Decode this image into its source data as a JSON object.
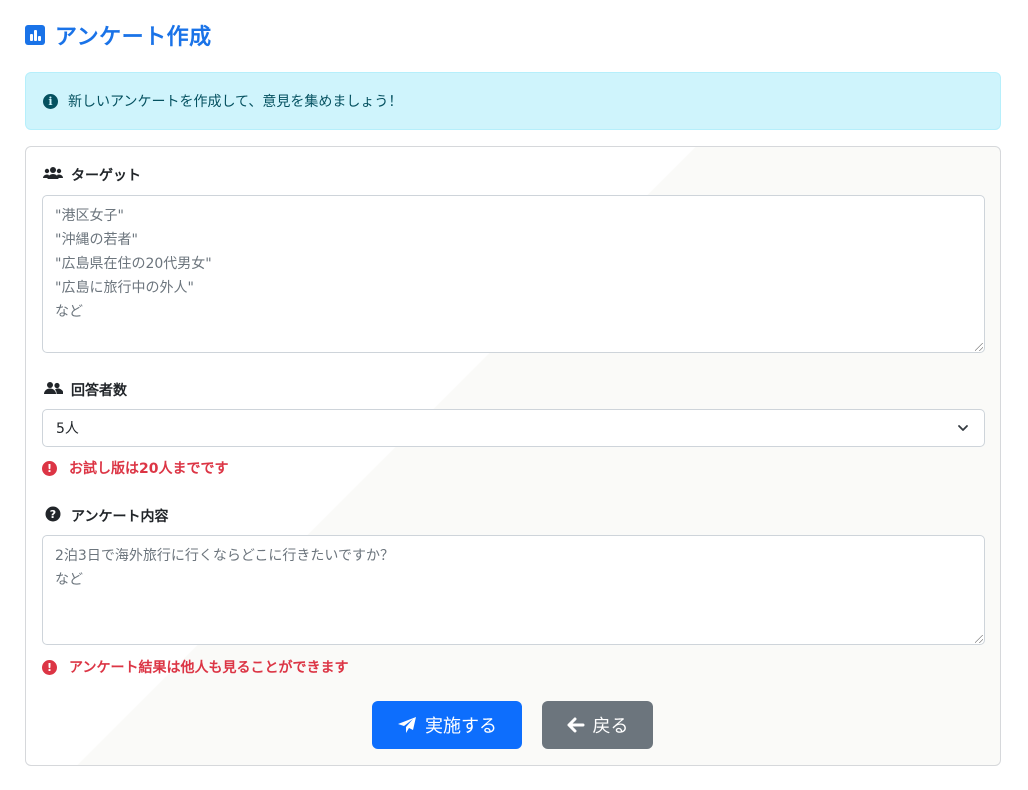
{
  "header": {
    "title": "アンケート作成",
    "icon": "bar-chart-icon"
  },
  "alert": {
    "icon": "info-icon",
    "text": "新しいアンケートを作成して、意見を集めましょう！"
  },
  "form": {
    "target": {
      "label": "ターゲット",
      "icon": "users-icon",
      "placeholder": "\"港区女子\"\n\"沖縄の若者\"\n\"広島県在住の20代男女\"\n\"広島に旅行中の外人\"\nなど"
    },
    "respondents": {
      "label": "回答者数",
      "icon": "user-friends-icon",
      "selected": "5人",
      "error": "お試し版は20人までです"
    },
    "content": {
      "label": "アンケート内容",
      "icon": "question-circle-icon",
      "placeholder": "2泊3日で海外旅行に行くならどこに行きたいですか？\nなど",
      "error": "アンケート結果は他人も見ることができます"
    }
  },
  "buttons": {
    "submit": {
      "label": "実施する",
      "icon": "paper-plane-icon"
    },
    "back": {
      "label": "戻る",
      "icon": "arrow-left-icon"
    }
  },
  "colors": {
    "primary": "#1a73e8",
    "button_primary": "#0d6efd",
    "button_secondary": "#6c757d",
    "alert_bg": "#cff4fc",
    "error": "#dc3545"
  }
}
